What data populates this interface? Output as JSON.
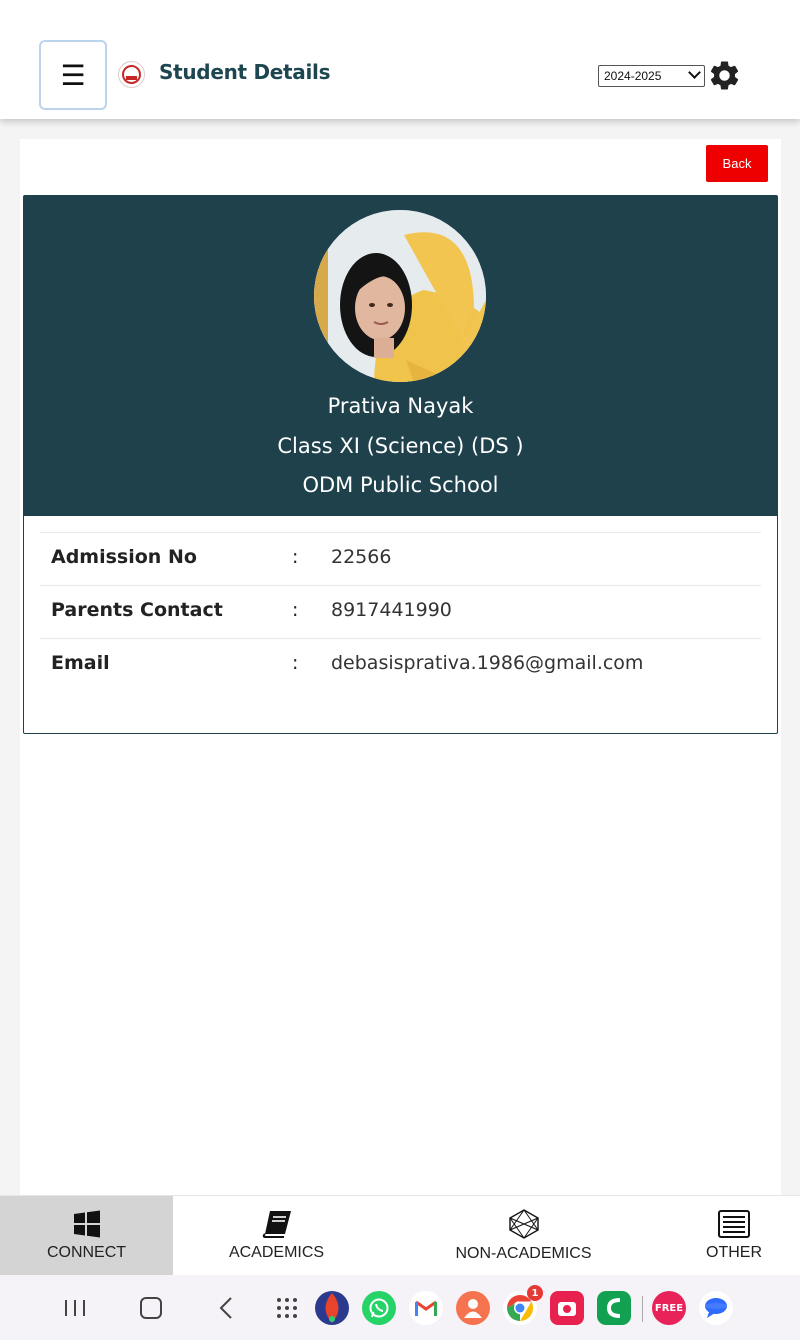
{
  "header": {
    "menu_icon": "☰",
    "title": "Student Details",
    "year_selected": "2024-2025"
  },
  "actions": {
    "back_label": "Back"
  },
  "student": {
    "name": "Prativa Nayak",
    "class": "Class XI (Science) (DS )",
    "school": "ODM Public School"
  },
  "details": [
    {
      "label": "Admission No",
      "value": "22566"
    },
    {
      "label": "Parents Contact",
      "value": "8917441990"
    },
    {
      "label": "Email",
      "value": "debasisprativa.1986@gmail.com"
    }
  ],
  "separator": ":",
  "bottom_nav": [
    {
      "label": "CONNECT",
      "icon": "windows-icon",
      "active": true
    },
    {
      "label": "ACADEMICS",
      "icon": "book-icon",
      "active": false
    },
    {
      "label": "NON-ACADEMICS",
      "icon": "network-icon",
      "active": false
    },
    {
      "label": "OTHER",
      "icon": "list-icon",
      "active": false
    }
  ],
  "system_bar": {
    "chrome_badge": "1",
    "free_app_label": "FREE"
  },
  "colors": {
    "banner": "#1e414c",
    "back_button": "#ee0000",
    "title": "#1e4651"
  }
}
